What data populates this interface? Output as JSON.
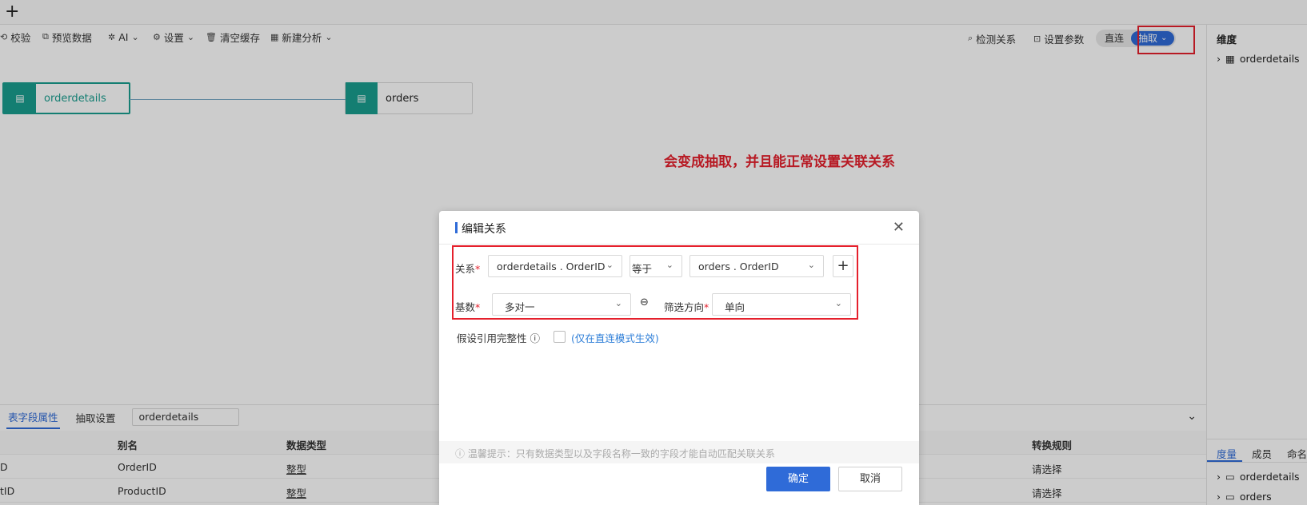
{
  "toolbar": {
    "add_label": "+",
    "items": [
      {
        "label": "校验"
      },
      {
        "label": "预览数据"
      },
      {
        "label": "AI"
      },
      {
        "label": "设置"
      },
      {
        "label": "清空缓存"
      },
      {
        "label": "新建分析"
      }
    ],
    "detect_relation": "检测关系",
    "set_params": "设置参数",
    "mode_direct": "直连",
    "mode_extract": "抽取"
  },
  "canvas": {
    "nodes": [
      {
        "label": "orderdetails",
        "selected": true
      },
      {
        "label": "orders",
        "selected": false
      }
    ],
    "annotation": "会变成抽取，并且能正常设置关联关系",
    "annotation_color": "#e5202c"
  },
  "right_panel": {
    "heading": "维度",
    "dimension_items": [
      "orderdetails"
    ],
    "tabs": [
      "度量",
      "成员",
      "命名"
    ],
    "measure_items": [
      "orderdetails",
      "orders"
    ]
  },
  "bottom_panel": {
    "tabs": [
      "表字段属性",
      "抽取设置"
    ],
    "table_name": "orderdetails",
    "columns": {
      "alias": "别名",
      "data_type": "数据类型",
      "convert_rule": "转换规则"
    },
    "rows": [
      {
        "name_fragment": "D",
        "alias": "OrderID",
        "data_type": "整型",
        "convert_rule": "请选择"
      },
      {
        "name_fragment": "tID",
        "alias": "ProductID",
        "data_type": "整型",
        "convert_rule": "请选择"
      }
    ]
  },
  "dialog": {
    "title": "编辑关系",
    "relation_label": "关系",
    "left_field": "orderdetails . OrderID",
    "operator": "等于",
    "right_field": "orders . OrderID",
    "cardinality_label": "基数",
    "cardinality_value": "多对一",
    "filter_dir_label": "筛选方向",
    "filter_dir_value": "单向",
    "integrity_label": "假设引用完整性",
    "integrity_note": "(仅在直连模式生效)",
    "hint": "温馨提示：只有数据类型以及字段名称一致的字段才能自动匹配关联关系",
    "ok": "确定",
    "cancel": "取消"
  },
  "colors": {
    "accent": "#2f6bd8",
    "node": "#1a9e8f",
    "highlight": "#e5202c"
  }
}
